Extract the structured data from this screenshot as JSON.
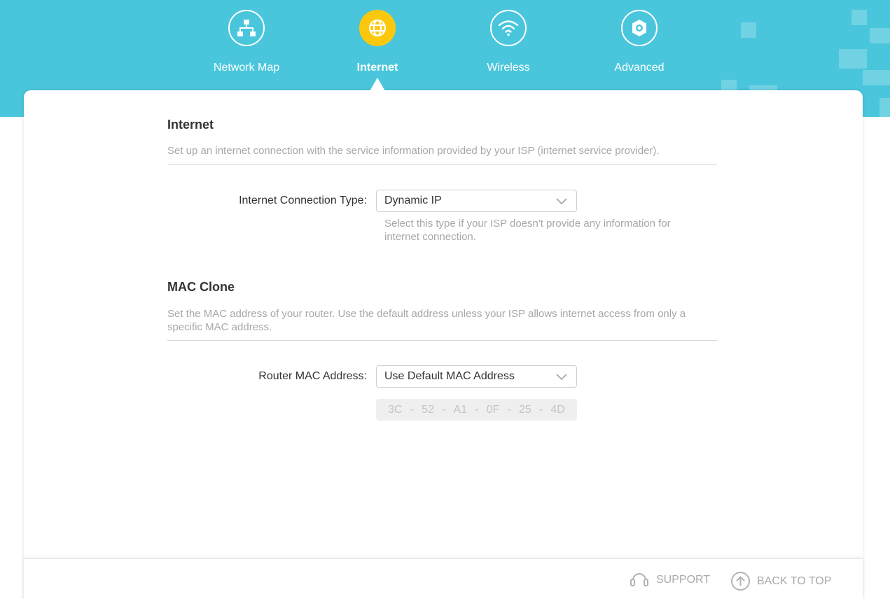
{
  "nav": {
    "items": [
      {
        "label": "Network Map",
        "icon": "network-map-icon"
      },
      {
        "label": "Internet",
        "icon": "globe-icon",
        "active": true
      },
      {
        "label": "Wireless",
        "icon": "wifi-icon"
      },
      {
        "label": "Advanced",
        "icon": "gear-icon"
      }
    ]
  },
  "internet": {
    "title": "Internet",
    "description": "Set up an internet connection with the service information provided by your ISP (internet service provider).",
    "connection_type_label": "Internet Connection Type:",
    "connection_type_value": "Dynamic IP",
    "connection_type_help": "Select this type if your ISP doesn't provide any information for internet connection."
  },
  "mac_clone": {
    "title": "MAC Clone",
    "description": "Set the MAC address of your router. Use the default address unless your ISP allows internet access from only a specific MAC address.",
    "router_mac_label": "Router MAC Address:",
    "router_mac_value": "Use Default MAC Address",
    "mac_octets": [
      "3C",
      "52",
      "A1",
      "0F",
      "25",
      "4D"
    ],
    "separator": "-"
  },
  "footer": {
    "support_label": "SUPPORT",
    "back_to_top_label": "BACK TO TOP"
  },
  "colors": {
    "header_bg": "#4ac6dc",
    "active_accent": "#fcc80e",
    "muted_text": "#a7a7a7"
  }
}
